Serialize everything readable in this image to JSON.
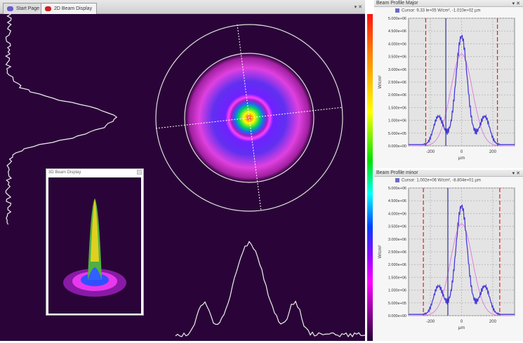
{
  "tabs": [
    {
      "label": "Start Page",
      "active": false
    },
    {
      "label": "2D Beam Display",
      "active": true
    }
  ],
  "tab_controls": "▾ ✕",
  "inset": {
    "title": "3D Beam Display"
  },
  "panels": [
    {
      "title": "Beam Profile Major",
      "cursor": "Cursor: 9.33 le+05 W/cm², -1.010e+02 µm",
      "controls": "▾ ✕"
    },
    {
      "title": "Beam Profile minor",
      "cursor": "Cursor: 1.002e+06 W/cm², -8.804e+01 µm",
      "controls": "▾ ✕"
    }
  ],
  "colors": {
    "background": "#2a0438",
    "measured": "#4a3cd8",
    "gaussian": "#e080e0",
    "clip": "#e02020"
  },
  "chart_data": [
    {
      "type": "line",
      "title": "Beam Profile Major",
      "xlabel": "µm",
      "ylabel": "W/cm²",
      "xlim": [
        -340,
        340
      ],
      "ylim": [
        0,
        5000000
      ],
      "yticks": [
        "0.000e+00",
        "5.000e+05",
        "1.000e+06",
        "1.500e+06",
        "2.000e+06",
        "2.500e+06",
        "3.000e+06",
        "3.500e+06",
        "4.000e+06",
        "4.500e+06",
        "5.000e+06"
      ],
      "xticks": [
        "-200",
        "0",
        "200"
      ],
      "xtick_values": [
        -200,
        0,
        200
      ],
      "cursor_x": -101,
      "clip_x": [
        -230,
        230
      ]
    },
    {
      "type": "line",
      "title": "Beam Profile minor",
      "xlabel": "µm",
      "ylabel": "W/cm²",
      "xlim": [
        -340,
        340
      ],
      "ylim": [
        0,
        5000000
      ],
      "yticks": [
        "0.000e+00",
        "5.000e+05",
        "1.000e+06",
        "1.500e+06",
        "2.000e+06",
        "2.500e+06",
        "3.000e+06",
        "3.500e+06",
        "4.000e+06",
        "4.500e+06",
        "5.000e+06"
      ],
      "xticks": [
        "-200",
        "0",
        "200"
      ],
      "xtick_values": [
        -200,
        0,
        200
      ],
      "cursor_x": -88,
      "clip_x": [
        -245,
        245
      ]
    }
  ]
}
